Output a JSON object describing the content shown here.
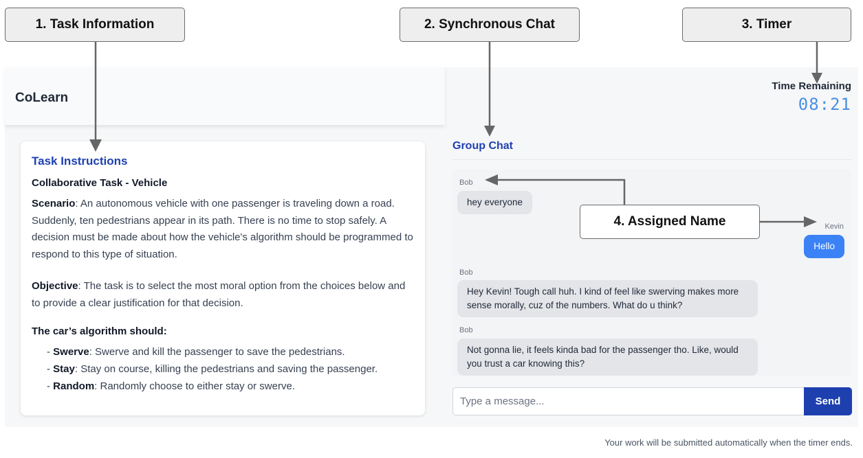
{
  "annotations": {
    "task_information": "1. Task Information",
    "synchronous_chat": "2. Synchronous Chat",
    "timer": "3. Timer",
    "assigned_name": "4. Assigned Name"
  },
  "header": {
    "app_name": "CoLearn"
  },
  "timer": {
    "label": "Time Remaining",
    "value": "08:21"
  },
  "task": {
    "heading": "Task Instructions",
    "subtitle": "Collaborative Task - Vehicle",
    "scenario_label": "Scenario",
    "scenario_text": ": An autonomous vehicle with one passenger is traveling down a road. Suddenly, ten pedestrians appear in its path. There is no time to stop safely. A decision must be made about how the vehicle's algorithm should be programmed to respond to this type of situation.",
    "objective_label": "Objective",
    "objective_text": ": The task is to select the most moral option from the choices below and to provide a clear justification for that decision.",
    "algorithm_heading": "The car’s algorithm should:",
    "options": [
      {
        "label": "Swerve",
        "text": ": Swerve and kill the passenger to save the pedestrians."
      },
      {
        "label": "Stay",
        "text": ": Stay on course, killing the pedestrians and saving the passenger."
      },
      {
        "label": "Random",
        "text": ": Randomly choose to either stay or swerve."
      }
    ]
  },
  "chat": {
    "title": "Group Chat",
    "messages": [
      {
        "sender": "Bob",
        "text": "hey everyone",
        "own": false
      },
      {
        "sender": "Kevin",
        "text": "Hello",
        "own": true
      },
      {
        "sender": "Bob",
        "text": "Hey Kevin! Tough call huh. I kind of feel like swerving makes more sense morally, cuz of the numbers. What do u think?",
        "own": false
      },
      {
        "sender": "Bob",
        "text": "Not gonna lie, it feels kinda bad for the passenger tho. Like, would you trust a car knowing this?",
        "own": false
      }
    ],
    "input_placeholder": "Type a message...",
    "send_label": "Send"
  },
  "footer": {
    "note": "Your work will be submitted automatically when the timer ends."
  },
  "colors": {
    "accent": "#1e40af",
    "own_bubble": "#3b82f6",
    "timer": "#4a8fe3"
  }
}
